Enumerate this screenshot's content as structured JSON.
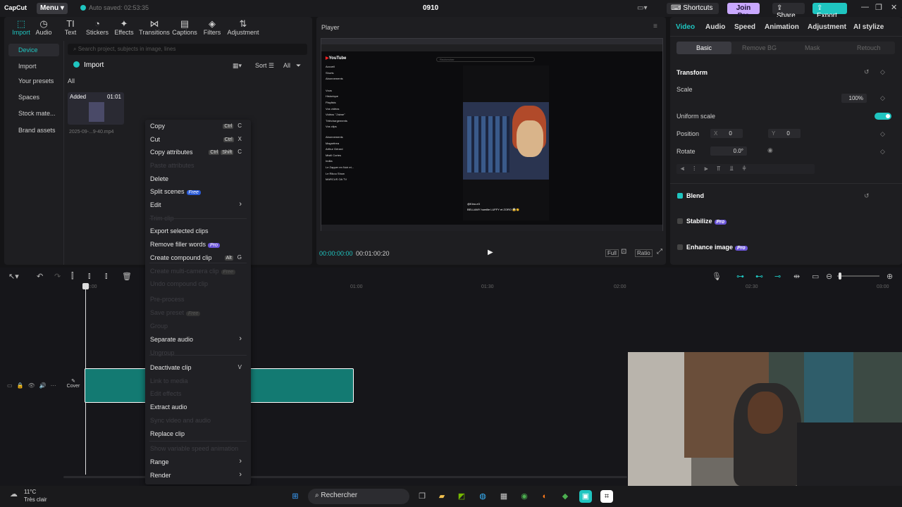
{
  "titlebar": {
    "logo": "CapCut",
    "menu": "Menu",
    "autosave": "Auto saved: 02:53:35",
    "project_title": "0910",
    "shortcuts": "Shortcuts",
    "join_pro": "Join Pro",
    "share": "Share",
    "export": "Export"
  },
  "toolbar": [
    "Import",
    "Audio",
    "Text",
    "Stickers",
    "Effects",
    "Transitions",
    "Captions",
    "Filters",
    "Adjustment"
  ],
  "sidebar": [
    "Device",
    "Import",
    "Your presets",
    "Spaces",
    "Stock mate...",
    "Brand assets"
  ],
  "media": {
    "search_placeholder": "Search project, subjects in image, lines",
    "import_label": "Import",
    "sort_label": "Sort",
    "all_filter": "All",
    "all_tab": "All",
    "added_label": "Added",
    "duration": "01:01",
    "filename": "2025-09-...9-40.mp4"
  },
  "player": {
    "title": "Player",
    "current_time": "00:00:00:00",
    "total_time": "00:01:00:20",
    "full": "Full",
    "ratio": "Ratio"
  },
  "inspector": {
    "tabs": [
      "Video",
      "Audio",
      "Speed",
      "Animation",
      "Adjustment",
      "AI stylize"
    ],
    "subtabs": [
      "Basic",
      "Remove BG",
      "Mask",
      "Retouch"
    ],
    "transform": "Transform",
    "scale": "Scale",
    "scale_value": "100%",
    "uniform_scale": "Uniform scale",
    "position": "Position",
    "pos_x_label": "X",
    "pos_x": "0",
    "pos_y_label": "Y",
    "pos_y": "0",
    "rotate": "Rotate",
    "rotate_value": "0.0°",
    "blend": "Blend",
    "stabilize": "Stabilize",
    "enhance_image": "Enhance image",
    "pro_badge": "Pro"
  },
  "timeline": {
    "ruler": [
      "00:00",
      "01:00",
      "01:30",
      "02:00",
      "02:30",
      "03:00"
    ],
    "cover": "Cover"
  },
  "context_menu": [
    {
      "label": "Copy",
      "keys": [
        "Ctrl",
        "C"
      ],
      "disabled": false
    },
    {
      "label": "Cut",
      "keys": [
        "Ctrl",
        "X"
      ],
      "disabled": false
    },
    {
      "label": "Copy attributes",
      "keys": [
        "Ctrl",
        "Shift",
        "C"
      ],
      "disabled": false
    },
    {
      "label": "Paste attributes",
      "keys": [],
      "disabled": true
    },
    {
      "label": "Delete",
      "keys": [],
      "disabled": false
    },
    {
      "label": "Split scenes",
      "badge": "Free",
      "keys": [],
      "disabled": false
    },
    {
      "label": "Edit",
      "submenu": true,
      "keys": [],
      "disabled": false
    },
    {
      "label": "Trim clip",
      "keys": [],
      "disabled": true
    },
    {
      "label": "Export selected clips",
      "keys": [],
      "disabled": false
    },
    {
      "label": "Remove filler words",
      "badge": "Pro",
      "keys": [],
      "disabled": false
    },
    {
      "label": "Create compound clip",
      "keys": [
        "Alt",
        "G"
      ],
      "disabled": false
    },
    {
      "label": "Create multi-camera clip",
      "badge": "Free",
      "keys": [],
      "disabled": true
    },
    {
      "label": "Undo compound clip",
      "keys": [],
      "disabled": true
    },
    {
      "label": "Pre-process",
      "keys": [],
      "disabled": true
    },
    {
      "label": "Save preset",
      "badge": "Free",
      "keys": [],
      "disabled": true
    },
    {
      "label": "Group",
      "keys": [],
      "disabled": true
    },
    {
      "label": "Separate audio",
      "submenu": true,
      "keys": [],
      "disabled": false
    },
    {
      "label": "Ungroup",
      "keys": [],
      "disabled": true
    },
    {
      "label": "Deactivate clip",
      "keys": [
        "V"
      ],
      "disabled": false
    },
    {
      "label": "Link to media",
      "keys": [],
      "disabled": true
    },
    {
      "label": "Edit effects",
      "keys": [],
      "disabled": true
    },
    {
      "label": "Extract audio",
      "keys": [],
      "disabled": false
    },
    {
      "label": "Sync video and audio",
      "keys": [],
      "disabled": true
    },
    {
      "label": "Replace clip",
      "keys": [],
      "disabled": false
    },
    {
      "label": "Show variable speed animation",
      "keys": [],
      "disabled": true
    },
    {
      "label": "Range",
      "submenu": true,
      "keys": [],
      "disabled": false
    },
    {
      "label": "Render",
      "submenu": true,
      "keys": [],
      "disabled": false
    }
  ],
  "taskbar": {
    "temperature": "11°C",
    "weather": "Très clair",
    "search": "Rechercher"
  },
  "youtube": {
    "logo": "YouTube",
    "nav": [
      "Accueil",
      "Shorts",
      "Abonnements",
      "Vous",
      "Historique",
      "Playlists",
      "Vos vidéos",
      "Vidéos \"J'aime\"",
      "Téléchargements",
      "Vos clips"
    ],
    "subs_header": "Abonnements",
    "subs": [
      "Magnétrea",
      "Arthur Gérard",
      "Mistil Cortes",
      "Indila",
      "Le Zapper en Noir et...",
      "Le Rikou Show",
      "MARCUS OA TV"
    ],
    "search_placeholder": "Rechercher",
    "caption": "BELLAMY humilie LUFFY et ZORO 😱👏",
    "channel": "@Kino-e3"
  }
}
